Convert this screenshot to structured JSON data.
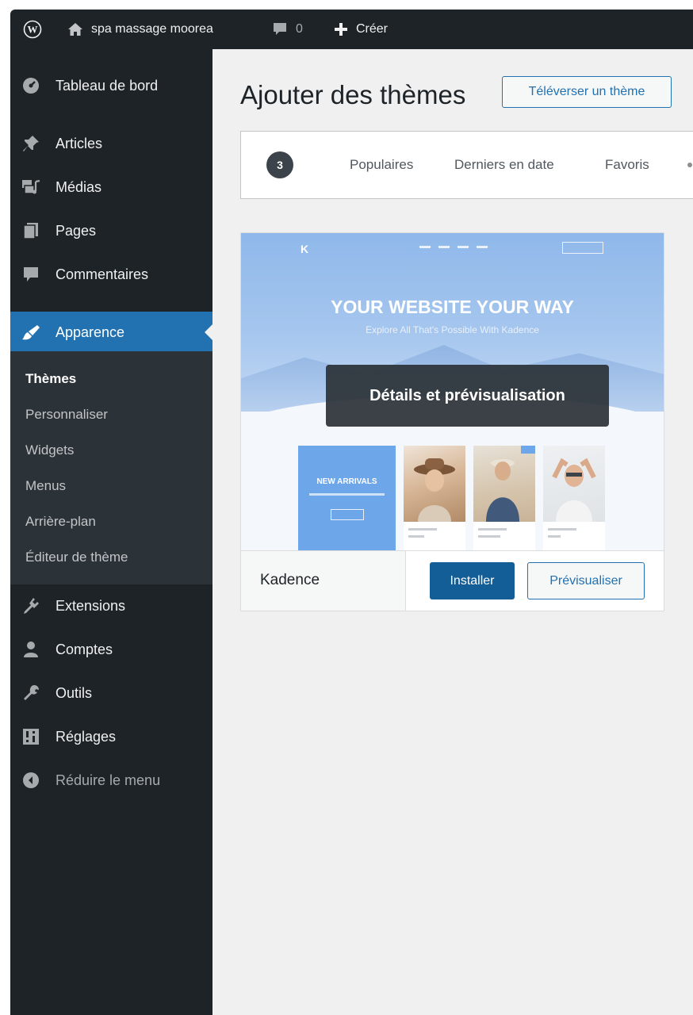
{
  "admin_bar": {
    "site_name": "spa massage moorea",
    "comments_count": "0",
    "create_label": "Créer"
  },
  "sidebar": {
    "items": [
      {
        "label": "Tableau de bord",
        "icon": "dashboard-icon"
      },
      {
        "label": "Articles",
        "icon": "pin-icon"
      },
      {
        "label": "Médias",
        "icon": "media-icon"
      },
      {
        "label": "Pages",
        "icon": "pages-icon"
      },
      {
        "label": "Commentaires",
        "icon": "comment-icon"
      },
      {
        "label": "Apparence",
        "icon": "brush-icon",
        "active": true
      },
      {
        "label": "Extensions",
        "icon": "plugin-icon"
      },
      {
        "label": "Comptes",
        "icon": "users-icon"
      },
      {
        "label": "Outils",
        "icon": "wrench-icon"
      },
      {
        "label": "Réglages",
        "icon": "settings-icon"
      }
    ],
    "submenu": [
      "Thèmes",
      "Personnaliser",
      "Widgets",
      "Menus",
      "Arrière-plan",
      "Éditeur de thème"
    ],
    "collapse_label": "Réduire le menu"
  },
  "main": {
    "title": "Ajouter des thèmes",
    "upload_button": "Téléverser un thème",
    "theme_count": "3",
    "filters": [
      "Populaires",
      "Derniers en date",
      "Favoris"
    ]
  },
  "theme_card": {
    "hero_title": "YOUR WEBSITE YOUR WAY",
    "hero_subtitle": "Explore All That's Possible With Kadence",
    "new_arrivals": "NEW ARRIVALS",
    "overlay_label": "Détails et prévisualisation",
    "name": "Kadence",
    "install_button": "Installer",
    "preview_button": "Prévisualiser"
  },
  "colors": {
    "admin_dark": "#1d2327",
    "accent_blue": "#2271b1",
    "install_blue": "#135e96",
    "submenu_bg": "#2c3338"
  }
}
